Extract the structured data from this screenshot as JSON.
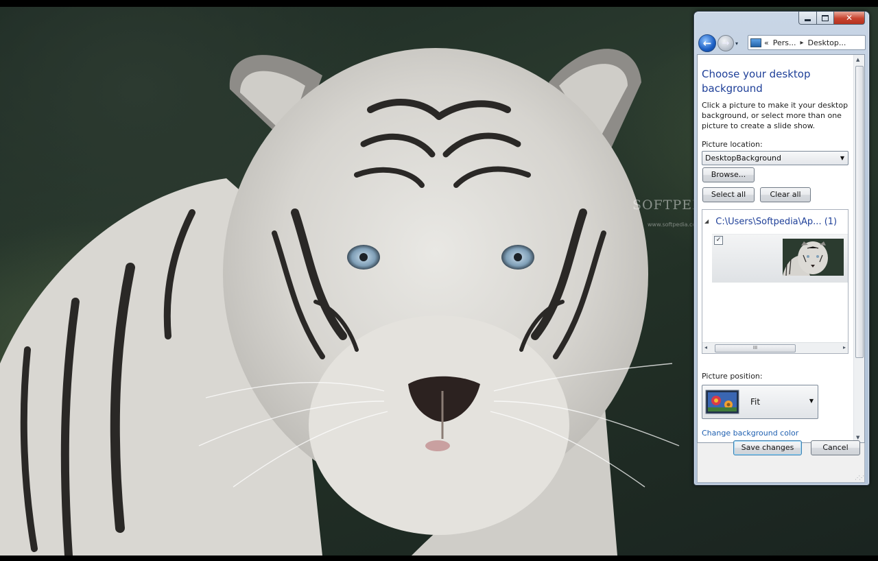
{
  "desktop": {
    "watermark": "SOFTPEDIA",
    "watermark_url": "www.softpedia.com"
  },
  "window": {
    "caption": {
      "minimize": "minimize-icon",
      "maximize": "maximize-icon",
      "close": "✕"
    },
    "nav": {
      "back": "←",
      "forward": "→",
      "history": "▾"
    },
    "breadcrumb": {
      "overflow": "«",
      "items": [
        "Pers...",
        "Desktop..."
      ],
      "separator": "▸"
    },
    "title": "Choose your desktop background",
    "description": "Click a picture to make it your desktop background, or select more than one picture to create a slide show.",
    "picture_location": {
      "label": "Picture location:",
      "value": "DesktopBackground",
      "caret": "▼"
    },
    "buttons": {
      "browse": "Browse...",
      "select_all": "Select all",
      "clear_all": "Clear all",
      "save": "Save changes",
      "cancel": "Cancel"
    },
    "pictures": {
      "group_toggle": "◢",
      "group_title": "C:\\Users\\Softpedia\\Ap... (1)",
      "items": [
        {
          "checked": "✓"
        }
      ],
      "scroll_grip": "III"
    },
    "picture_position": {
      "label": "Picture position:",
      "value": "Fit",
      "caret": "▼"
    },
    "change_color_link": "Change background color",
    "colors": {
      "title_blue": "#1e3f98",
      "link_blue": "#1e5fb0",
      "close_red": "#c7432f"
    }
  }
}
